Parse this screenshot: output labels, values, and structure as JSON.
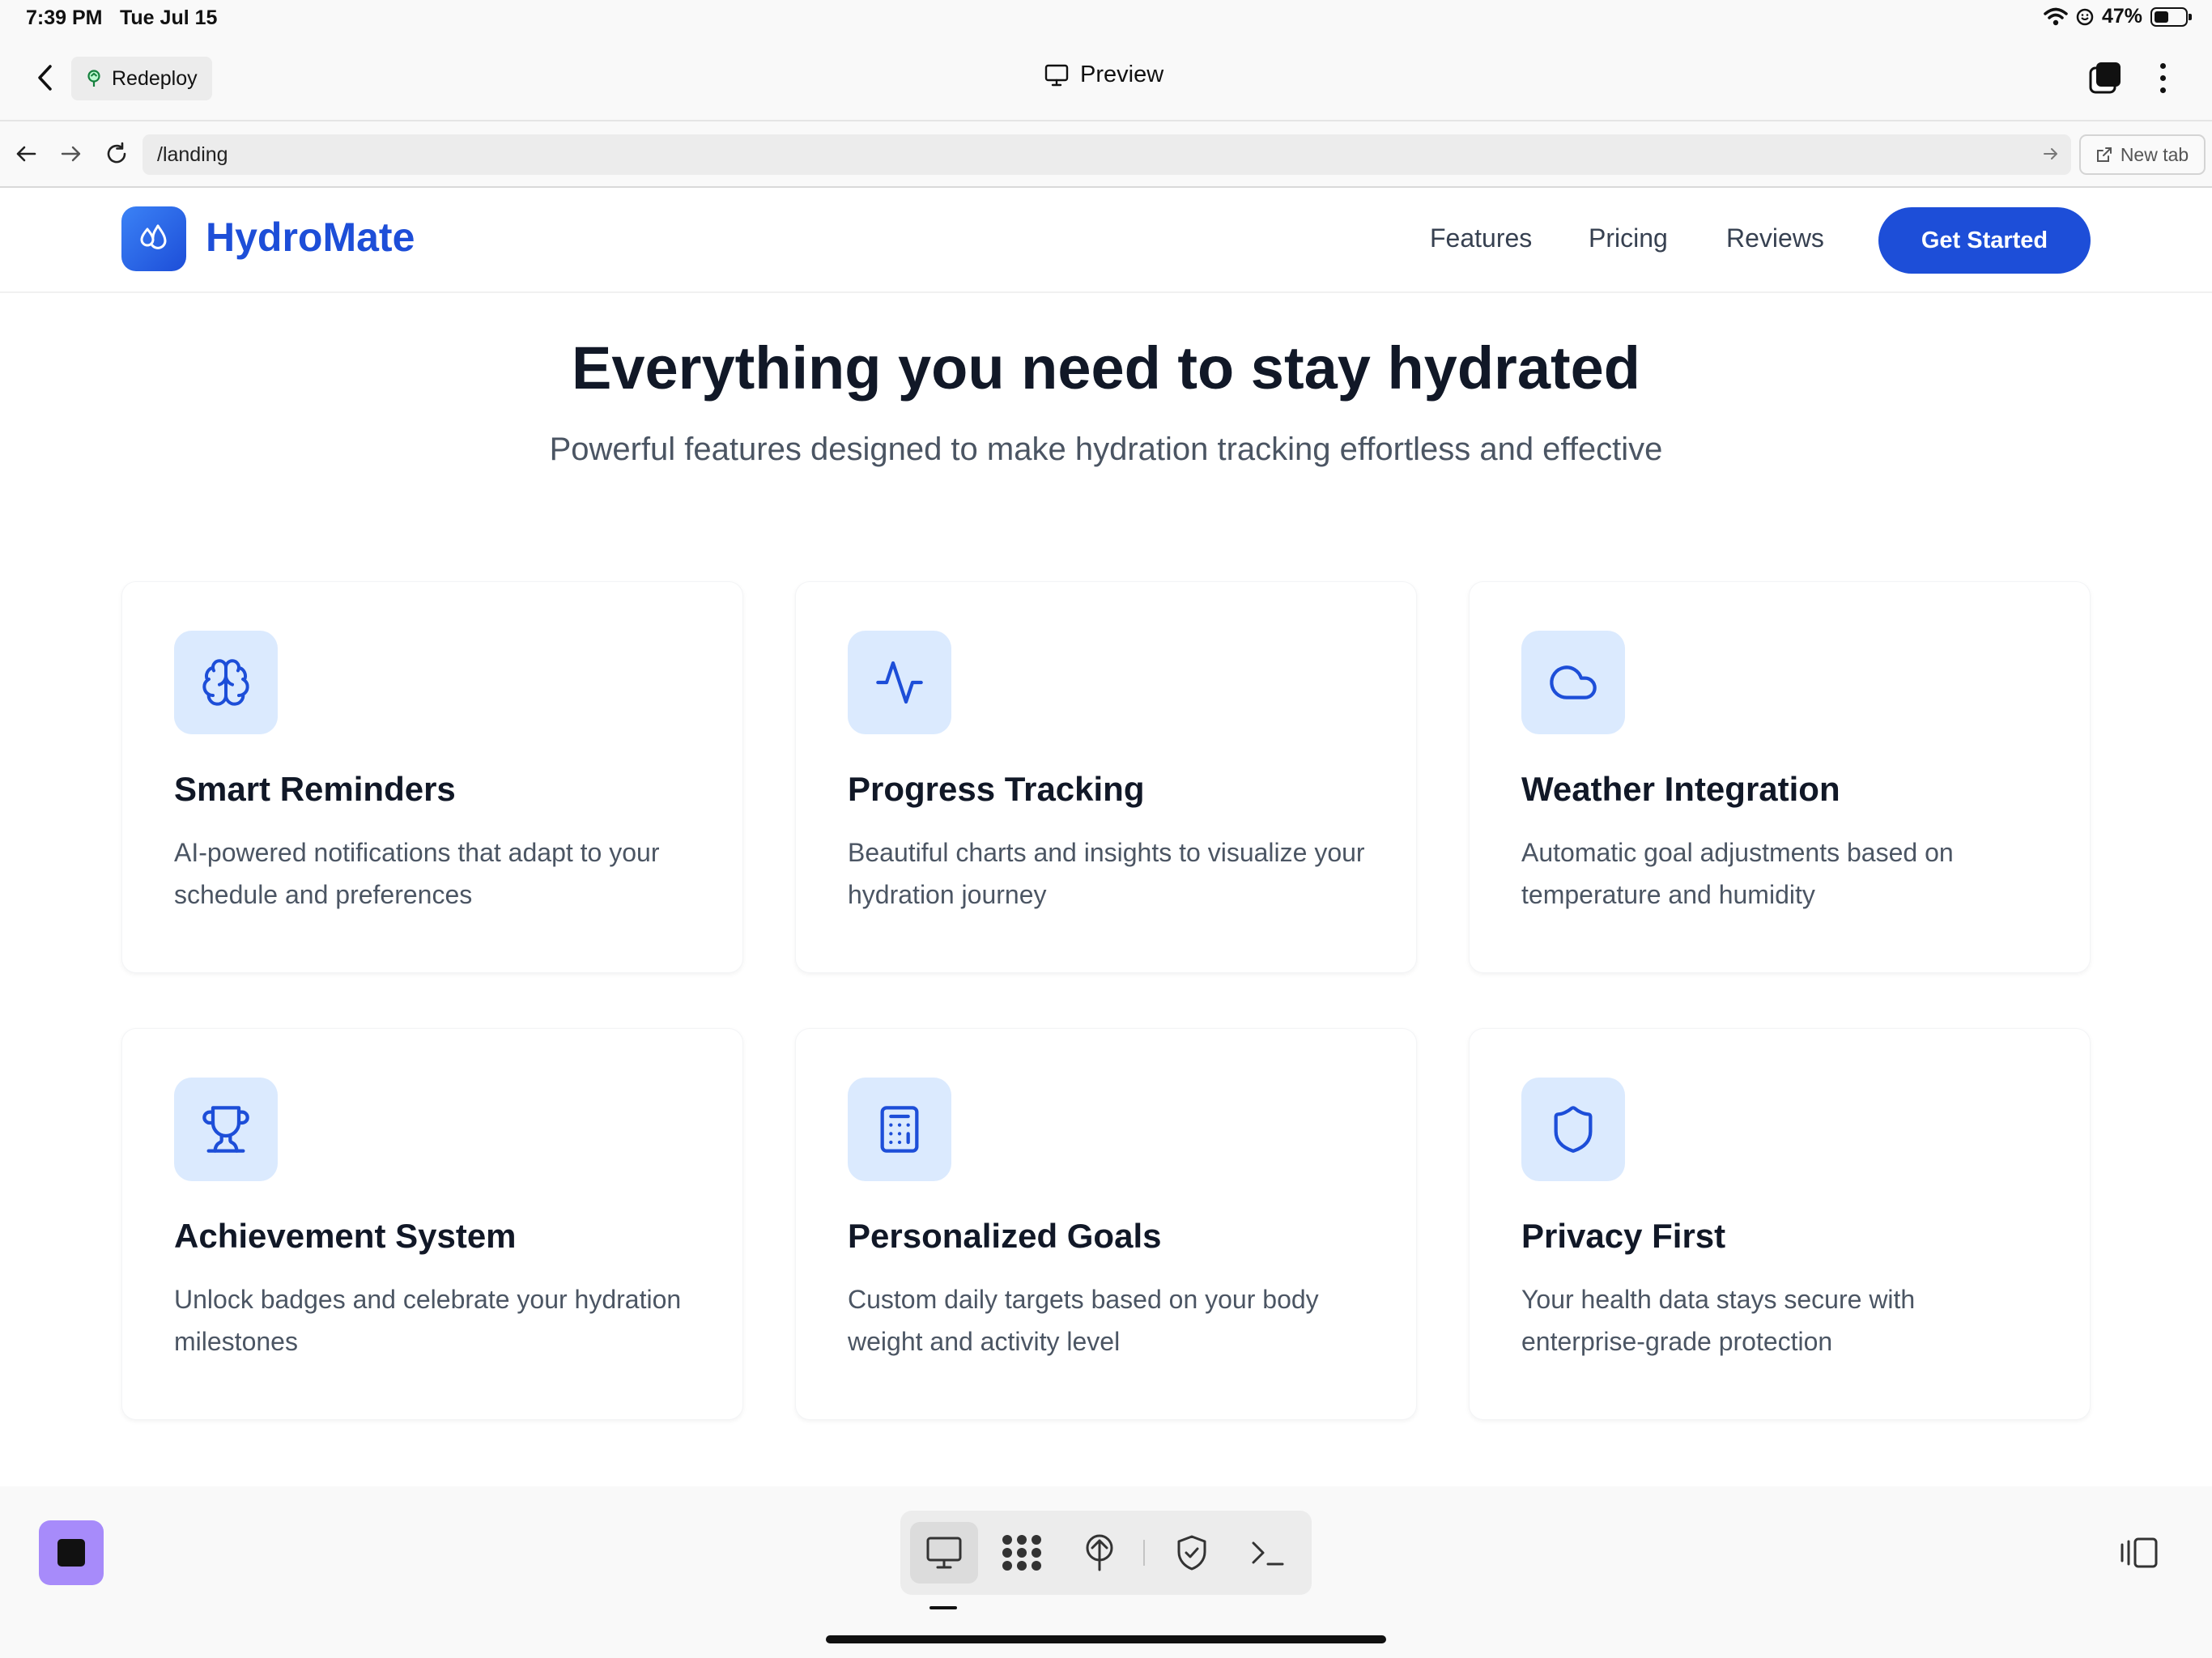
{
  "status_bar": {
    "time": "7:39 PM",
    "date": "Tue Jul 15",
    "battery": "47%",
    "battery_level": 0.47
  },
  "app_header": {
    "redeploy_label": "Redeploy",
    "preview_label": "Preview"
  },
  "browser": {
    "url": "/landing",
    "new_tab_label": "New tab"
  },
  "site": {
    "brand": "HydroMate",
    "nav": [
      "Features",
      "Pricing",
      "Reviews"
    ],
    "cta": "Get Started",
    "accent": "#1d4ed8"
  },
  "hero": {
    "title": "Everything you need to stay hydrated",
    "subtitle": "Powerful features designed to make hydration tracking effortless and effective"
  },
  "features": [
    {
      "icon": "brain-icon",
      "title": "Smart Reminders",
      "desc": "AI-powered notifications that adapt to your schedule and preferences"
    },
    {
      "icon": "activity-icon",
      "title": "Progress Tracking",
      "desc": "Beautiful charts and insights to visualize your hydration journey"
    },
    {
      "icon": "cloud-icon",
      "title": "Weather Integration",
      "desc": "Automatic goal adjustments based on temperature and humidity"
    },
    {
      "icon": "trophy-icon",
      "title": "Achievement System",
      "desc": "Unlock badges and celebrate your hydration milestones"
    },
    {
      "icon": "calculator-icon",
      "title": "Personalized Goals",
      "desc": "Custom daily targets based on your body weight and activity level"
    },
    {
      "icon": "shield-icon",
      "title": "Privacy First",
      "desc": "Your health data stays secure with enterprise-grade protection"
    }
  ],
  "toolbar": {
    "tools": [
      "monitor-icon",
      "apps-grid-icon",
      "deploy-icon",
      "shield-check-icon",
      "terminal-icon"
    ],
    "active_tool": "monitor-icon"
  }
}
